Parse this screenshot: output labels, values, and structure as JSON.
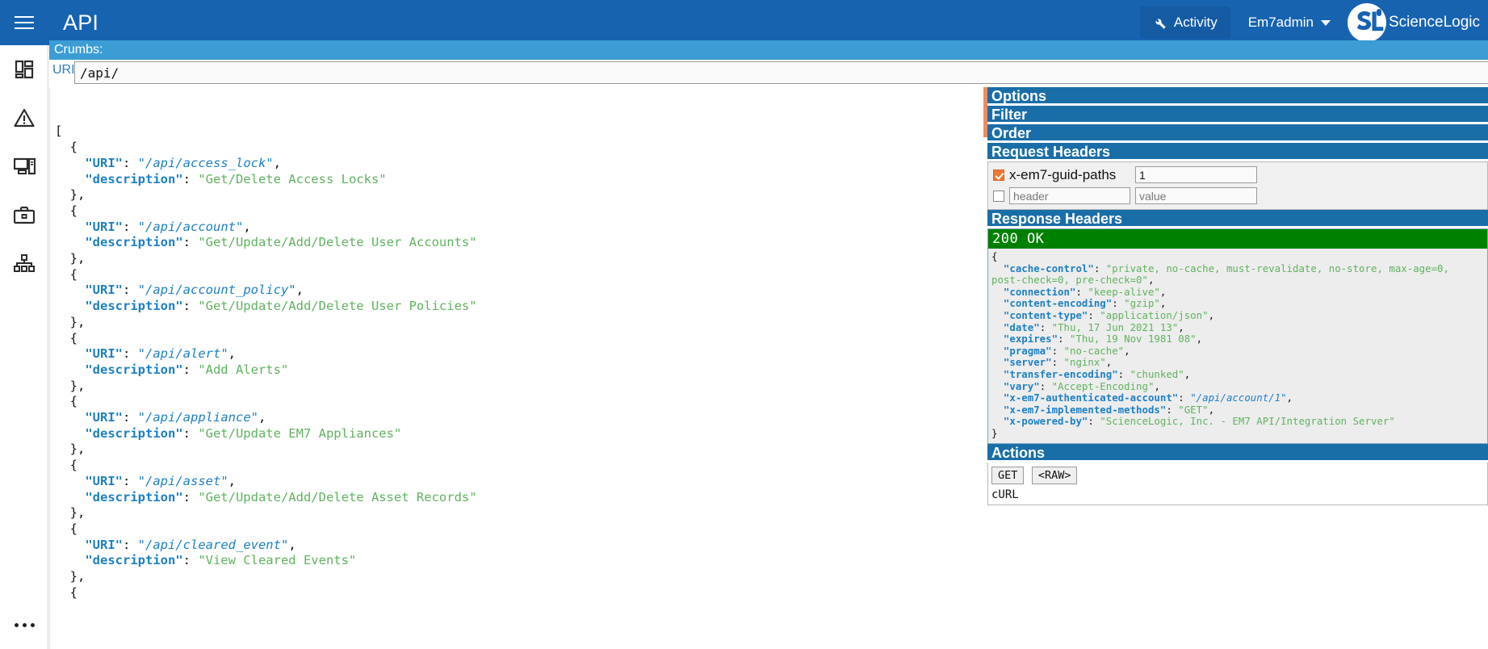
{
  "topbar": {
    "app_title": "API",
    "menu_icon": "hamburger-icon",
    "activity_label": "Activity",
    "activity_icon": "wrench-icon",
    "user_label": "Em7admin",
    "brand_text": "ScienceLogic",
    "bg_color": "#1763b0"
  },
  "sidebar": {
    "items": [
      {
        "icon": "dashboard-icon",
        "name": "dashboards"
      },
      {
        "icon": "warning-triangle-icon",
        "name": "events"
      },
      {
        "icon": "devices-icon",
        "name": "devices"
      },
      {
        "icon": "briefcase-icon",
        "name": "business-services"
      },
      {
        "icon": "org-chart-icon",
        "name": "topology"
      }
    ],
    "more_icon": "more-horizontal-icon"
  },
  "crumbs": {
    "label": "Crumbs:",
    "bg_color": "#3b9dd4"
  },
  "uri": {
    "label": "URI",
    "value": "/api/",
    "placeholder": "/api/"
  },
  "response_body": {
    "lines": [
      [
        {
          "t": "punct",
          "v": "["
        }
      ],
      [
        {
          "t": "punct",
          "v": "  {"
        }
      ],
      [
        {
          "t": "jkey",
          "v": "    \"URI\""
        },
        {
          "t": "punct",
          "v": ": "
        },
        {
          "t": "jlink",
          "v": "\"/api/access_lock\""
        },
        {
          "t": "punct",
          "v": ","
        }
      ],
      [
        {
          "t": "jkey",
          "v": "    \"description\""
        },
        {
          "t": "punct",
          "v": ": "
        },
        {
          "t": "jstr",
          "v": "\"Get/Delete Access Locks\""
        }
      ],
      [
        {
          "t": "punct",
          "v": "  },"
        }
      ],
      [
        {
          "t": "punct",
          "v": "  {"
        }
      ],
      [
        {
          "t": "jkey",
          "v": "    \"URI\""
        },
        {
          "t": "punct",
          "v": ": "
        },
        {
          "t": "jlink",
          "v": "\"/api/account\""
        },
        {
          "t": "punct",
          "v": ","
        }
      ],
      [
        {
          "t": "jkey",
          "v": "    \"description\""
        },
        {
          "t": "punct",
          "v": ": "
        },
        {
          "t": "jstr",
          "v": "\"Get/Update/Add/Delete User Accounts\""
        }
      ],
      [
        {
          "t": "punct",
          "v": "  },"
        }
      ],
      [
        {
          "t": "punct",
          "v": "  {"
        }
      ],
      [
        {
          "t": "jkey",
          "v": "    \"URI\""
        },
        {
          "t": "punct",
          "v": ": "
        },
        {
          "t": "jlink",
          "v": "\"/api/account_policy\""
        },
        {
          "t": "punct",
          "v": ","
        }
      ],
      [
        {
          "t": "jkey",
          "v": "    \"description\""
        },
        {
          "t": "punct",
          "v": ": "
        },
        {
          "t": "jstr",
          "v": "\"Get/Update/Add/Delete User Policies\""
        }
      ],
      [
        {
          "t": "punct",
          "v": "  },"
        }
      ],
      [
        {
          "t": "punct",
          "v": "  {"
        }
      ],
      [
        {
          "t": "jkey",
          "v": "    \"URI\""
        },
        {
          "t": "punct",
          "v": ": "
        },
        {
          "t": "jlink",
          "v": "\"/api/alert\""
        },
        {
          "t": "punct",
          "v": ","
        }
      ],
      [
        {
          "t": "jkey",
          "v": "    \"description\""
        },
        {
          "t": "punct",
          "v": ": "
        },
        {
          "t": "jstr",
          "v": "\"Add Alerts\""
        }
      ],
      [
        {
          "t": "punct",
          "v": "  },"
        }
      ],
      [
        {
          "t": "punct",
          "v": "  {"
        }
      ],
      [
        {
          "t": "jkey",
          "v": "    \"URI\""
        },
        {
          "t": "punct",
          "v": ": "
        },
        {
          "t": "jlink",
          "v": "\"/api/appliance\""
        },
        {
          "t": "punct",
          "v": ","
        }
      ],
      [
        {
          "t": "jkey",
          "v": "    \"description\""
        },
        {
          "t": "punct",
          "v": ": "
        },
        {
          "t": "jstr",
          "v": "\"Get/Update EM7 Appliances\""
        }
      ],
      [
        {
          "t": "punct",
          "v": "  },"
        }
      ],
      [
        {
          "t": "punct",
          "v": "  {"
        }
      ],
      [
        {
          "t": "jkey",
          "v": "    \"URI\""
        },
        {
          "t": "punct",
          "v": ": "
        },
        {
          "t": "jlink",
          "v": "\"/api/asset\""
        },
        {
          "t": "punct",
          "v": ","
        }
      ],
      [
        {
          "t": "jkey",
          "v": "    \"description\""
        },
        {
          "t": "punct",
          "v": ": "
        },
        {
          "t": "jstr",
          "v": "\"Get/Update/Add/Delete Asset Records\""
        }
      ],
      [
        {
          "t": "punct",
          "v": "  },"
        }
      ],
      [
        {
          "t": "punct",
          "v": "  {"
        }
      ],
      [
        {
          "t": "jkey",
          "v": "    \"URI\""
        },
        {
          "t": "punct",
          "v": ": "
        },
        {
          "t": "jlink",
          "v": "\"/api/cleared_event\""
        },
        {
          "t": "punct",
          "v": ","
        }
      ],
      [
        {
          "t": "jkey",
          "v": "    \"description\""
        },
        {
          "t": "punct",
          "v": ": "
        },
        {
          "t": "jstr",
          "v": "\"View Cleared Events\""
        }
      ],
      [
        {
          "t": "punct",
          "v": "  },"
        }
      ],
      [
        {
          "t": "punct",
          "v": "  {"
        }
      ]
    ]
  },
  "panel": {
    "options_label": "Options",
    "filter_label": "Filter",
    "order_label": "Order",
    "request_headers_label": "Request Headers",
    "response_headers_label": "Response Headers",
    "actions_label": "Actions",
    "accent_color": "#ef8b5c",
    "header_color": "#1a6ea8"
  },
  "request_headers": {
    "rows": [
      {
        "checked": true,
        "name": "x-em7-guid-paths",
        "value": "1",
        "name_placeholder": "",
        "value_placeholder": ""
      },
      {
        "checked": false,
        "name": "",
        "value": "",
        "name_placeholder": "header",
        "value_placeholder": "value"
      }
    ]
  },
  "response_headers": {
    "status": "200 OK",
    "status_color": "#008000",
    "lines": [
      [
        {
          "t": "punct",
          "v": "{"
        }
      ],
      [
        {
          "t": "jkey",
          "v": "  \"cache-control\""
        },
        {
          "t": "punct",
          "v": ": "
        },
        {
          "t": "jstr",
          "v": "\"private, no-cache, must-revalidate, no-store, max-age=0, post-check=0, pre-check=0\""
        },
        {
          "t": "punct",
          "v": ","
        }
      ],
      [
        {
          "t": "jkey",
          "v": "  \"connection\""
        },
        {
          "t": "punct",
          "v": ": "
        },
        {
          "t": "jstr",
          "v": "\"keep-alive\""
        },
        {
          "t": "punct",
          "v": ","
        }
      ],
      [
        {
          "t": "jkey",
          "v": "  \"content-encoding\""
        },
        {
          "t": "punct",
          "v": ": "
        },
        {
          "t": "jstr",
          "v": "\"gzip\""
        },
        {
          "t": "punct",
          "v": ","
        }
      ],
      [
        {
          "t": "jkey",
          "v": "  \"content-type\""
        },
        {
          "t": "punct",
          "v": ": "
        },
        {
          "t": "jstr",
          "v": "\"application/json\""
        },
        {
          "t": "punct",
          "v": ","
        }
      ],
      [
        {
          "t": "jkey",
          "v": "  \"date\""
        },
        {
          "t": "punct",
          "v": ": "
        },
        {
          "t": "jstr",
          "v": "\"Thu, 17 Jun 2021 13\""
        },
        {
          "t": "punct",
          "v": ","
        }
      ],
      [
        {
          "t": "jkey",
          "v": "  \"expires\""
        },
        {
          "t": "punct",
          "v": ": "
        },
        {
          "t": "jstr",
          "v": "\"Thu, 19 Nov 1981 08\""
        },
        {
          "t": "punct",
          "v": ","
        }
      ],
      [
        {
          "t": "jkey",
          "v": "  \"pragma\""
        },
        {
          "t": "punct",
          "v": ": "
        },
        {
          "t": "jstr",
          "v": "\"no-cache\""
        },
        {
          "t": "punct",
          "v": ","
        }
      ],
      [
        {
          "t": "jkey",
          "v": "  \"server\""
        },
        {
          "t": "punct",
          "v": ": "
        },
        {
          "t": "jstr",
          "v": "\"nginx\""
        },
        {
          "t": "punct",
          "v": ","
        }
      ],
      [
        {
          "t": "jkey",
          "v": "  \"transfer-encoding\""
        },
        {
          "t": "punct",
          "v": ": "
        },
        {
          "t": "jstr",
          "v": "\"chunked\""
        },
        {
          "t": "punct",
          "v": ","
        }
      ],
      [
        {
          "t": "jkey",
          "v": "  \"vary\""
        },
        {
          "t": "punct",
          "v": ": "
        },
        {
          "t": "jstr",
          "v": "\"Accept-Encoding\""
        },
        {
          "t": "punct",
          "v": ","
        }
      ],
      [
        {
          "t": "jkey",
          "v": "  \"x-em7-authenticated-account\""
        },
        {
          "t": "punct",
          "v": ": "
        },
        {
          "t": "jlink",
          "v": "\"/api/account/1\""
        },
        {
          "t": "punct",
          "v": ","
        }
      ],
      [
        {
          "t": "jkey",
          "v": "  \"x-em7-implemented-methods\""
        },
        {
          "t": "punct",
          "v": ": "
        },
        {
          "t": "jstr",
          "v": "\"GET\""
        },
        {
          "t": "punct",
          "v": ","
        }
      ],
      [
        {
          "t": "jkey",
          "v": "  \"x-powered-by\""
        },
        {
          "t": "punct",
          "v": ": "
        },
        {
          "t": "jstr",
          "v": "\"ScienceLogic, Inc. - EM7 API/Integration Server\""
        }
      ],
      [
        {
          "t": "punct",
          "v": "}"
        }
      ]
    ]
  },
  "actions": {
    "get_label": "GET",
    "raw_label": "<RAW>",
    "curl_label": "cURL"
  }
}
